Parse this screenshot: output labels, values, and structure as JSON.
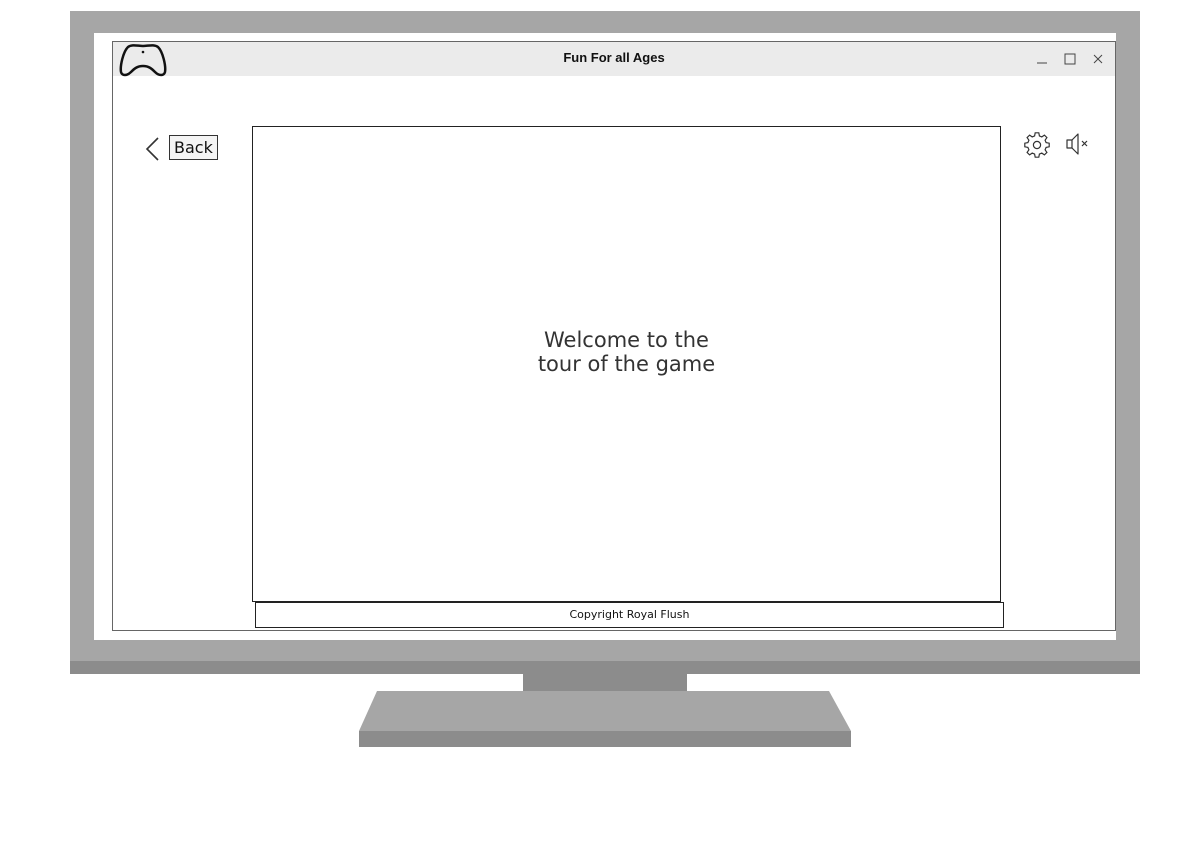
{
  "window": {
    "title": "Fun For all Ages",
    "logo_icon": "game-controller-icon",
    "controls": {
      "minimize_icon": "minimize-icon",
      "maximize_icon": "maximize-icon",
      "close_icon": "close-icon"
    }
  },
  "nav": {
    "back_icon": "chevron-left-icon",
    "back_label": "Back"
  },
  "toolbar": {
    "settings_icon": "gear-icon",
    "mute_icon": "speaker-muted-icon"
  },
  "main": {
    "welcome_text": "Welcome to the\ntour of the game"
  },
  "footer": {
    "copyright": "Copyright Royal Flush"
  },
  "colors": {
    "monitor_bezel": "#a6a6a6",
    "monitor_chin": "#8c8c8c",
    "title_bar": "#ebebeb"
  }
}
